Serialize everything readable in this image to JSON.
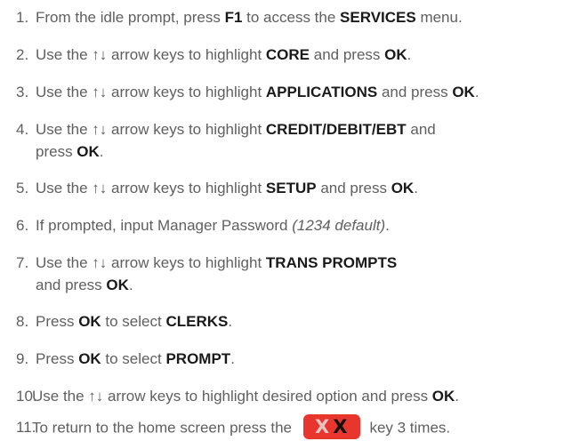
{
  "steps": [
    {
      "num": "1.",
      "a": "From the idle prompt, press ",
      "b": "F1",
      "c": " to access the ",
      "d": "SERVICES",
      "e": " menu."
    },
    {
      "num": "2.",
      "a": "Use the ↑↓ arrow keys to highlight ",
      "b": "CORE",
      "c": " and press ",
      "d": "OK",
      "e": "."
    },
    {
      "num": "3.",
      "a": "Use the ↑↓ arrow keys to highlight ",
      "b": "APPLICATIONS",
      "c": " and press ",
      "d": "OK",
      "e": "."
    },
    {
      "num": "4.",
      "a": "Use the ↑↓ arrow keys to highlight ",
      "b": "CREDIT/DEBIT/EBT",
      "c": " and",
      "line2a": "press ",
      "line2b": "OK",
      "line2c": "."
    },
    {
      "num": "5.",
      "a": "Use the ↑↓ arrow keys to highlight ",
      "b": "SETUP",
      "c": " and press ",
      "d": "OK",
      "e": "."
    },
    {
      "num": "6.",
      "a": "If prompted, input Manager Password ",
      "b": "(1234 default)",
      "c": "."
    },
    {
      "num": "7.",
      "a": "Use the ↑↓ arrow keys to highlight ",
      "b": "TRANS PROMPTS",
      "line2a": "and press ",
      "line2b": "OK",
      "line2c": "."
    },
    {
      "num": "8.",
      "a": "Press ",
      "b": "OK",
      "c": " to select ",
      "d": "CLERKS",
      "e": "."
    },
    {
      "num": "9.",
      "a": "Press ",
      "b": "OK",
      "c": " to select ",
      "d": "PROMPT",
      "e": "."
    },
    {
      "num": "10.",
      "a": "Use the ↑↓ arrow keys to highlight desired option and press ",
      "b": "OK",
      "c": "."
    },
    {
      "num": "11.",
      "a": "To return to the home screen press the ",
      "key_x1": "X",
      "key_x2": "X",
      "b": " key 3 times."
    }
  ],
  "colors": {
    "text": "#5f5f5f",
    "keyword": "#1a1a1a",
    "cancel_key": "#e8362f"
  },
  "icons": {
    "cancel_key": "cancel-key-icon"
  }
}
